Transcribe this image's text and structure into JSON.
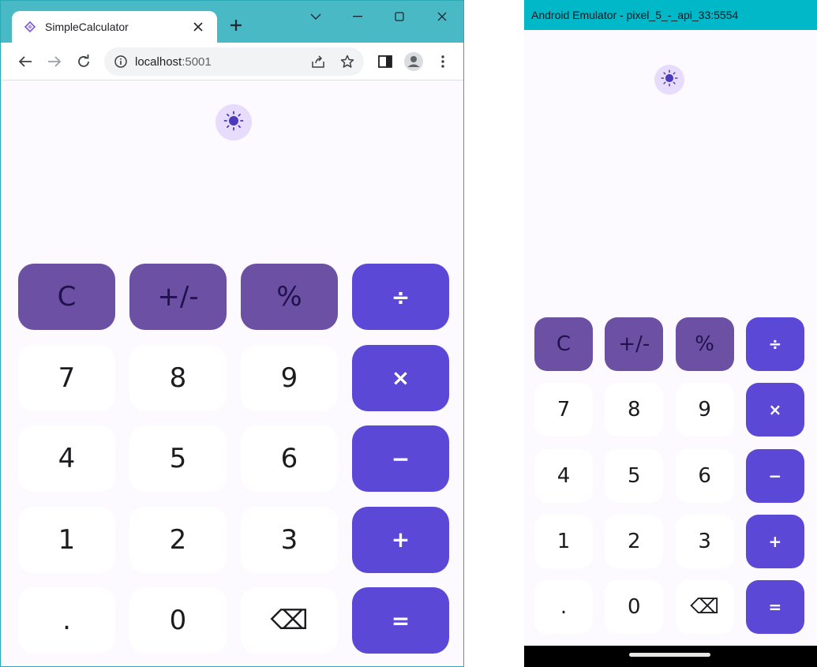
{
  "browser": {
    "tab_title": "SimpleCalculator",
    "tab_favicon": "blazor-favicon-icon",
    "url_host": "localhost",
    "url_port": ":5001",
    "icons": [
      "back-arrow-icon",
      "forward-arrow-icon",
      "reload-icon",
      "site-info-icon",
      "share-icon",
      "bookmark-star-icon",
      "side-panel-icon",
      "profile-icon",
      "menu-kebab-icon",
      "tab-search-chevron-icon",
      "minimize-icon",
      "maximize-icon",
      "close-icon",
      "new-tab-plus-icon"
    ]
  },
  "emulator": {
    "title": "Android Emulator - pixel_5_-_api_33:5554"
  },
  "calculator": {
    "theme_icon": "sun-icon",
    "display": "",
    "keys": [
      {
        "label": "C",
        "kind": "fn",
        "name": "clear-button"
      },
      {
        "label": "+/-",
        "kind": "fn",
        "name": "negate-button"
      },
      {
        "label": "%",
        "kind": "fn",
        "name": "percent-button"
      },
      {
        "label": "÷",
        "kind": "op",
        "name": "divide-button"
      },
      {
        "label": "7",
        "kind": "num",
        "name": "digit-7-button"
      },
      {
        "label": "8",
        "kind": "num",
        "name": "digit-8-button"
      },
      {
        "label": "9",
        "kind": "num",
        "name": "digit-9-button"
      },
      {
        "label": "×",
        "kind": "op",
        "name": "multiply-button"
      },
      {
        "label": "4",
        "kind": "num",
        "name": "digit-4-button"
      },
      {
        "label": "5",
        "kind": "num",
        "name": "digit-5-button"
      },
      {
        "label": "6",
        "kind": "num",
        "name": "digit-6-button"
      },
      {
        "label": "−",
        "kind": "op",
        "name": "subtract-button"
      },
      {
        "label": "1",
        "kind": "num",
        "name": "digit-1-button"
      },
      {
        "label": "2",
        "kind": "num",
        "name": "digit-2-button"
      },
      {
        "label": "3",
        "kind": "num",
        "name": "digit-3-button"
      },
      {
        "label": "+",
        "kind": "op",
        "name": "add-button"
      },
      {
        "label": ".",
        "kind": "num",
        "name": "decimal-button"
      },
      {
        "label": "0",
        "kind": "num",
        "name": "digit-0-button"
      },
      {
        "label": "⌫",
        "kind": "num",
        "name": "backspace-button"
      },
      {
        "label": "=",
        "kind": "op",
        "name": "equals-button"
      }
    ]
  },
  "colors": {
    "function_key": "#6c50a4",
    "operator_key": "#5c48d6",
    "number_key": "#ffffff",
    "background": "#fcf9ff",
    "theme_toggle": "#e8dcfd",
    "browser_frame": "#4ab9c6",
    "emulator_titlebar": "#00b8c8"
  }
}
